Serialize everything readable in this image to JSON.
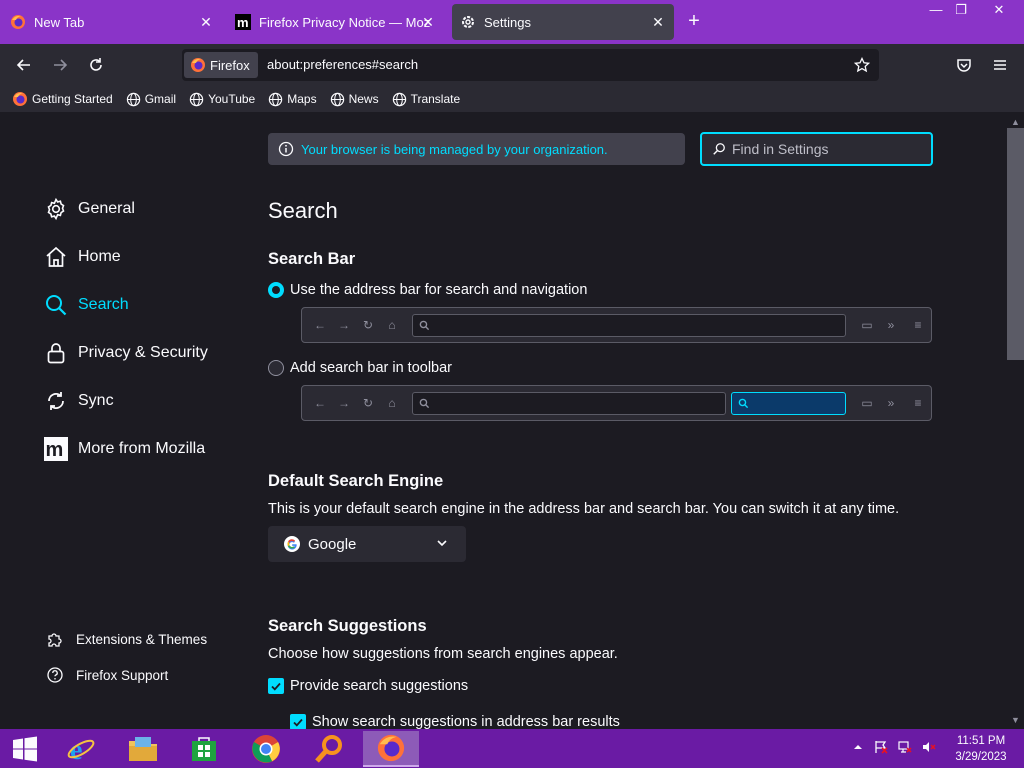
{
  "tabs": [
    {
      "title": "New Tab",
      "icon": "firefox-icon"
    },
    {
      "title": "Firefox Privacy Notice — Mozilla",
      "icon": "mozilla-m-icon"
    },
    {
      "title": "Settings",
      "icon": "gear-icon",
      "active": true
    }
  ],
  "window_controls": {
    "minimize": "—",
    "restore": "❐",
    "close": "✕"
  },
  "urlbar": {
    "identity_label": "Firefox",
    "url": "about:preferences#search"
  },
  "bookmarks": [
    "Getting Started",
    "Gmail",
    "YouTube",
    "Maps",
    "News",
    "Translate"
  ],
  "policy_notice": "Your browser is being managed by your organization.",
  "find": {
    "placeholder": "Find in Settings"
  },
  "sidebar": {
    "items": [
      {
        "label": "General",
        "icon": "gear-icon"
      },
      {
        "label": "Home",
        "icon": "home-icon"
      },
      {
        "label": "Search",
        "icon": "search-icon",
        "selected": true
      },
      {
        "label": "Privacy & Security",
        "icon": "lock-icon"
      },
      {
        "label": "Sync",
        "icon": "sync-icon"
      },
      {
        "label": "More from Mozilla",
        "icon": "mozilla-m-icon"
      }
    ],
    "footer": [
      {
        "label": "Extensions & Themes",
        "icon": "puzzle-icon"
      },
      {
        "label": "Firefox Support",
        "icon": "help-icon"
      }
    ]
  },
  "page_title": "Search",
  "search_bar": {
    "heading": "Search Bar",
    "option_address": "Use the address bar for search and navigation",
    "option_toolbar": "Add search bar in toolbar",
    "selected": "address"
  },
  "default_engine": {
    "heading": "Default Search Engine",
    "description": "This is your default search engine in the address bar and search bar. You can switch it at any time.",
    "value": "Google"
  },
  "suggestions": {
    "heading": "Search Suggestions",
    "description": "Choose how suggestions from search engines appear.",
    "provide_label": "Provide search suggestions",
    "provide_checked": true,
    "address_bar_label": "Show search suggestions in address bar results",
    "address_bar_checked": true
  },
  "taskbar": {
    "apps": [
      "start-icon",
      "internet-explorer-icon",
      "file-explorer-icon",
      "store-icon",
      "chrome-icon",
      "search-app-icon",
      "firefox-icon"
    ],
    "time": "11:51 PM",
    "date": "3/29/2023"
  },
  "colors": {
    "accent": "#00ddff",
    "tabstrip": "#8a34c8",
    "taskbar": "#6a1ba4",
    "background": "#1c1b22"
  }
}
